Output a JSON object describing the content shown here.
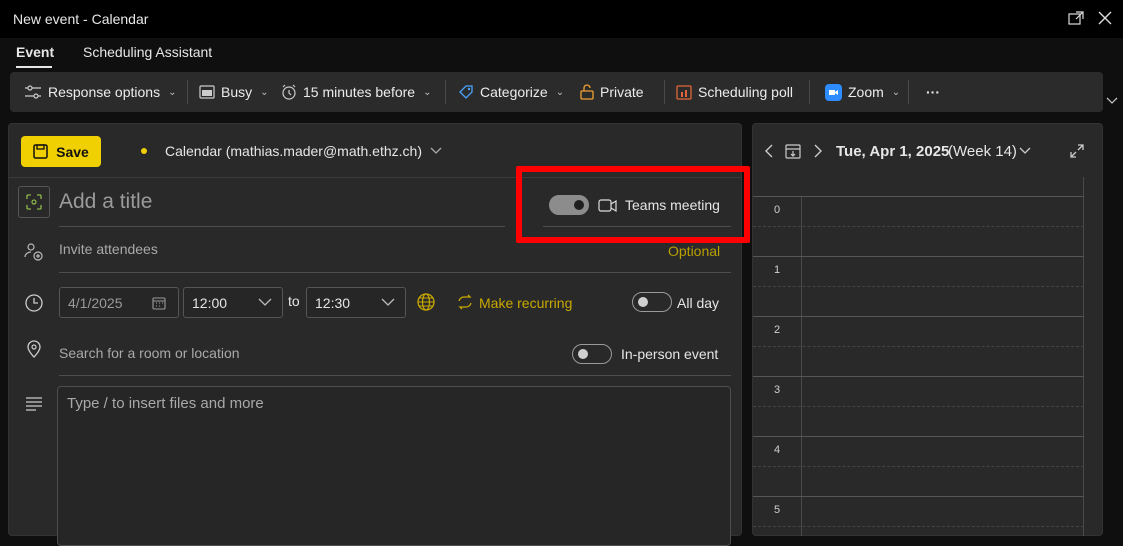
{
  "window": {
    "title": "New event - Calendar"
  },
  "tabs": [
    {
      "label": "Event",
      "active": true
    },
    {
      "label": "Scheduling Assistant",
      "active": false
    }
  ],
  "toolbar": {
    "response_options": "Response options",
    "busy": "Busy",
    "reminder": "15 minutes before",
    "categorize": "Categorize",
    "private": "Private",
    "scheduling_poll": "Scheduling poll",
    "zoom": "Zoom",
    "more": "···"
  },
  "event": {
    "save_label": "Save",
    "calendar": "Calendar (mathias.mader@math.ethz.ch)",
    "title_placeholder": "Add a title",
    "teams_meeting_label": "Teams meeting",
    "teams_meeting_on": true,
    "invite_placeholder": "Invite attendees",
    "optional_label": "Optional",
    "start_date": "4/1/2025",
    "start_time": "12:00",
    "to_label": "to",
    "end_time": "12:30",
    "make_recurring": "Make recurring",
    "all_day_label": "All day",
    "all_day_on": false,
    "location_placeholder": "Search for a room or location",
    "in_person_label": "In-person event",
    "in_person_on": false,
    "body_placeholder": "Type / to insert files and more"
  },
  "day_view": {
    "date_label": "Tue, Apr 1, 2025",
    "week_label": "(Week 14)",
    "hours": [
      "0",
      "1",
      "2",
      "3",
      "4",
      "5"
    ]
  },
  "colors": {
    "accent": "#f0d000",
    "highlight": "#ff0000",
    "background": "#292929"
  }
}
